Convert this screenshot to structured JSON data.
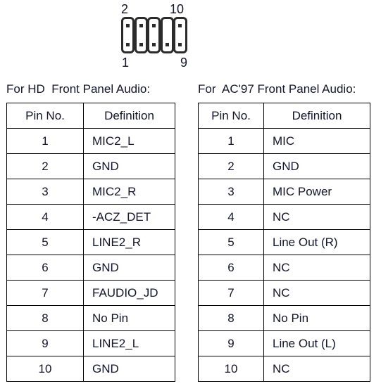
{
  "connector": {
    "name": "front-panel-audio-header",
    "top_left_label": "2",
    "top_right_label": "10",
    "bottom_left_label": "1",
    "bottom_right_label": "9",
    "slot_count": 5,
    "slots": [
      {
        "top_pin": true,
        "bottom_pin": true
      },
      {
        "top_pin": true,
        "bottom_pin": true
      },
      {
        "top_pin": true,
        "bottom_pin": true
      },
      {
        "top_pin": false,
        "bottom_pin": true
      },
      {
        "top_pin": true,
        "bottom_pin": true
      }
    ]
  },
  "colors": {
    "text": "#14142b",
    "border": "#000000",
    "connector_outline": "#2b2b2b",
    "background": "#ffffff"
  },
  "tables": {
    "hd": {
      "caption": "For HD  Front Panel Audio:",
      "columns": [
        "Pin No.",
        "Definition"
      ],
      "rows": [
        {
          "pin": "1",
          "definition": "MIC2_L"
        },
        {
          "pin": "2",
          "definition": "GND"
        },
        {
          "pin": "3",
          "definition": "MIC2_R"
        },
        {
          "pin": "4",
          "definition": "-ACZ_DET"
        },
        {
          "pin": "5",
          "definition": "LINE2_R"
        },
        {
          "pin": "6",
          "definition": "GND"
        },
        {
          "pin": "7",
          "definition": "FAUDIO_JD"
        },
        {
          "pin": "8",
          "definition": "No Pin"
        },
        {
          "pin": "9",
          "definition": "LINE2_L"
        },
        {
          "pin": "10",
          "definition": "GND"
        }
      ]
    },
    "ac97": {
      "caption": "For  AC'97 Front Panel Audio:",
      "columns": [
        "Pin No.",
        "Definition"
      ],
      "rows": [
        {
          "pin": "1",
          "definition": "MIC"
        },
        {
          "pin": "2",
          "definition": "GND"
        },
        {
          "pin": "3",
          "definition": "MIC Power"
        },
        {
          "pin": "4",
          "definition": "NC"
        },
        {
          "pin": "5",
          "definition": "Line Out (R)"
        },
        {
          "pin": "6",
          "definition": "NC"
        },
        {
          "pin": "7",
          "definition": "NC"
        },
        {
          "pin": "8",
          "definition": "No Pin"
        },
        {
          "pin": "9",
          "definition": "Line Out (L)"
        },
        {
          "pin": "10",
          "definition": "NC"
        }
      ]
    }
  }
}
